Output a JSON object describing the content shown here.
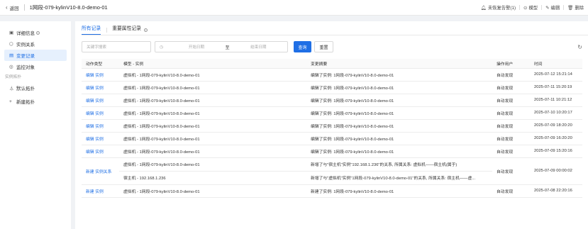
{
  "header": {
    "back_label": "返回",
    "title": "1网段-079-kylinV10-8.0-demo-01",
    "actions": [
      {
        "icon": "bell-icon",
        "label": "未恢复告警(1)"
      },
      {
        "icon": "model-icon",
        "label": "模型"
      },
      {
        "icon": "edit-icon",
        "label": "编辑"
      },
      {
        "icon": "trash-icon",
        "label": "删除"
      }
    ]
  },
  "sidebar": {
    "items": [
      {
        "icon": "detail-icon",
        "label": "详细信息",
        "active": false
      },
      {
        "icon": "relation-icon",
        "label": "实例关系",
        "active": false
      },
      {
        "icon": "record-icon",
        "label": "变更记录",
        "active": true
      },
      {
        "icon": "monitor-icon",
        "label": "监控对象",
        "active": false
      }
    ],
    "group_label": "实例拓扑",
    "topo_items": [
      {
        "icon": "topology-icon",
        "label": "默认拓扑"
      },
      {
        "icon": "plus-icon",
        "label": "新建拓扑"
      }
    ]
  },
  "tabs": [
    {
      "label": "所有记录",
      "active": true
    },
    {
      "label": "重要属性记录",
      "active": false
    }
  ],
  "filters": {
    "keyword_placeholder": "关键字搜索",
    "start_placeholder": "开始日期",
    "range_sep": "至",
    "end_placeholder": "结束日期",
    "search_label": "查询",
    "reset_label": "重置"
  },
  "table": {
    "columns": [
      "动作类型",
      "模型 - 实例",
      "变更摘要",
      "操作用户",
      "时间"
    ],
    "rows": [
      {
        "action": "编辑 实例",
        "instance": "虚拟机 - 1网段-079-kylinV10-8.0-demo-01",
        "summary": "编辑了实例: 1网段-079-kylinV10-8.0-demo-01",
        "user": "自动发现",
        "time": "2025-07-12 15:21:14"
      },
      {
        "action": "编辑 实例",
        "instance": "虚拟机 - 1网段-079-kylinV10-8.0-demo-01",
        "summary": "编辑了实例: 1网段-079-kylinV10-8.0-demo-01",
        "user": "自动发现",
        "time": "2025-07-11 15:20:19"
      },
      {
        "action": "编辑 实例",
        "instance": "虚拟机 - 1网段-079-kylinV10-8.0-demo-01",
        "summary": "编辑了实例: 1网段-079-kylinV10-8.0-demo-01",
        "user": "自动发现",
        "time": "2025-07-11 10:21:12"
      },
      {
        "action": "编辑 实例",
        "instance": "虚拟机 - 1网段-079-kylinV10-8.0-demo-01",
        "summary": "编辑了实例: 1网段-079-kylinV10-8.0-demo-01",
        "user": "自动发现",
        "time": "2025-07-10 10:20:17"
      },
      {
        "action": "编辑 实例",
        "instance": "虚拟机 - 1网段-079-kylinV10-8.0-demo-01",
        "summary": "编辑了实例: 1网段-079-kylinV10-8.0-demo-01",
        "user": "自动发现",
        "time": "2025-07-09 18:20:20"
      },
      {
        "action": "编辑 实例",
        "instance": "虚拟机 - 1网段-079-kylinV10-8.0-demo-01",
        "summary": "编辑了实例: 1网段-079-kylinV10-8.0-demo-01",
        "user": "自动发现",
        "time": "2025-07-09 16:20:20"
      },
      {
        "action": "编辑 实例",
        "instance": "虚拟机 - 1网段-079-kylinV10-8.0-demo-01",
        "summary": "编辑了实例: 1网段-079-kylinV10-8.0-demo-01",
        "user": "自动发现",
        "time": "2025-07-09 15:20:16"
      }
    ],
    "relation_row": {
      "action": "新建 实例关系",
      "instance_1": "虚拟机 - 1网段-079-kylinV10-8.0-demo-01",
      "instance_2": "宿主机 - 192.168.1.236",
      "summary_1": "新增了与\"宿主机\"实例\"192.168.1.236\"的关系, 所属关系: 虚拟机——宿主机(属于)",
      "summary_2": "新增了与\"虚拟机\"实例\"1网段-079-kylinV10-8.0-demo-01\"的关系, 所属关系: 宿主机——虚...",
      "user": "自动发现",
      "time": "2025-07-09 00:00:02"
    },
    "last_row": {
      "action": "新建 实例",
      "instance": "虚拟机 - 1网段-079-kylinV10-8.0-demo-01",
      "summary": "新建了实例: 1网段-079-kylinV10-8.0-demo-01",
      "user": "自动发现",
      "time": "2025-07-08 22:20:16"
    }
  }
}
